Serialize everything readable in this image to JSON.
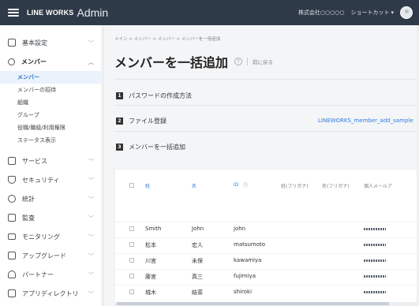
{
  "topbar": {
    "brand": "LINE WORKS",
    "brand_suffix": "Admin",
    "company": "株式会社○○○○○",
    "shortcut": "ショートカット",
    "caret": "▾"
  },
  "sidebar": {
    "items": [
      {
        "label": "基本設定",
        "icon": "gear-icon"
      },
      {
        "label": "メンバー",
        "icon": "user-icon"
      },
      {
        "label": "サービス",
        "icon": "service-icon"
      },
      {
        "label": "セキュリティ",
        "icon": "shield-icon"
      },
      {
        "label": "統計",
        "icon": "clock-icon"
      },
      {
        "label": "監査",
        "icon": "audit-icon"
      },
      {
        "label": "モニタリング",
        "icon": "monitor-icon"
      },
      {
        "label": "アップグレード",
        "icon": "upgrade-icon"
      },
      {
        "label": "パートナー",
        "icon": "partner-icon"
      },
      {
        "label": "アプリディレクトリ",
        "icon": "apps-icon"
      }
    ],
    "member_subitems": [
      "メンバー",
      "メンバーの招待",
      "組織",
      "グループ",
      "役職/職級/利用権限",
      "ステータス表示"
    ],
    "chevron": "﹀"
  },
  "main": {
    "breadcrumb": "メイン > メンバー > メンバー > メンバーを一括追加",
    "title": "メンバーを一括追加",
    "help": "?",
    "back": "前に戻る",
    "steps": [
      {
        "num": "1",
        "label": "パスワードの作成方法"
      },
      {
        "num": "2",
        "label": "ファイル登録"
      },
      {
        "num": "3",
        "label": "メンバーを一括追加"
      }
    ],
    "file_link": "LINEWORKS_member_add_sample"
  },
  "table": {
    "headers": [
      "姓",
      "名",
      "ID",
      "姓(フリガナ)",
      "名(フリガナ)",
      "個人メールア"
    ],
    "rows": [
      {
        "last": "Smith",
        "first": "John",
        "id": "john"
      },
      {
        "last": "松本",
        "first": "宏人",
        "id": "matsumoto"
      },
      {
        "last": "川宮",
        "first": "未保",
        "id": "kawamiya"
      },
      {
        "last": "藤宮",
        "first": "真三",
        "id": "fujimiya"
      },
      {
        "last": "城木",
        "first": "結菜",
        "id": "shiroki"
      }
    ]
  }
}
